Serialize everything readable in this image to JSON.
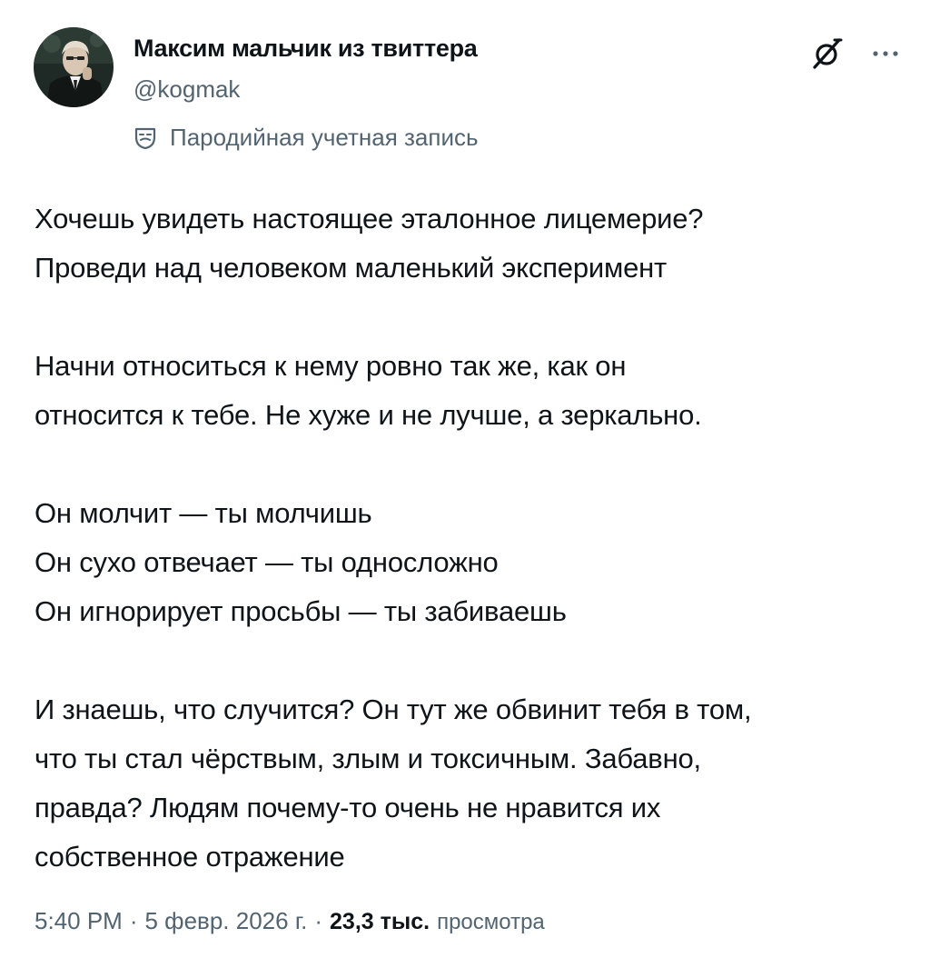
{
  "author": {
    "name": "Максим мальчик из твиттера",
    "handle": "@kogmak",
    "label": "Пародийная учетная запись"
  },
  "icons": {
    "avatar": "avatar-photo",
    "grok": "grok-icon",
    "more": "more-icon",
    "parody": "theater-mask-icon"
  },
  "tweet": {
    "lines": [
      "Хочешь увидеть настоящее эталонное лицемерие?",
      "Проведи над человеком маленький эксперимент",
      "",
      "Начни относиться к нему ровно так же, как он",
      "относится к тебе. Не хуже и не лучше, а зеркально.",
      "",
      "Он молчит — ты молчишь",
      "Он сухо отвечает — ты односложно",
      "Он игнорирует просьбы — ты забиваешь",
      "",
      "И знаешь, что случится? Он тут же обвинит тебя в том,",
      "что ты стал чёрствым, злым и токсичным. Забавно,",
      "правда? Людям почему-то очень не нравится их",
      "собственное отражение"
    ]
  },
  "meta": {
    "time": "5:40 PM",
    "separator": "·",
    "date": "5 февр. 2026 г.",
    "views_count": "23,3 тыс.",
    "views_label": "просмотра"
  },
  "colors": {
    "text_primary": "#0f1419",
    "text_secondary": "#536471",
    "background": "#ffffff"
  }
}
